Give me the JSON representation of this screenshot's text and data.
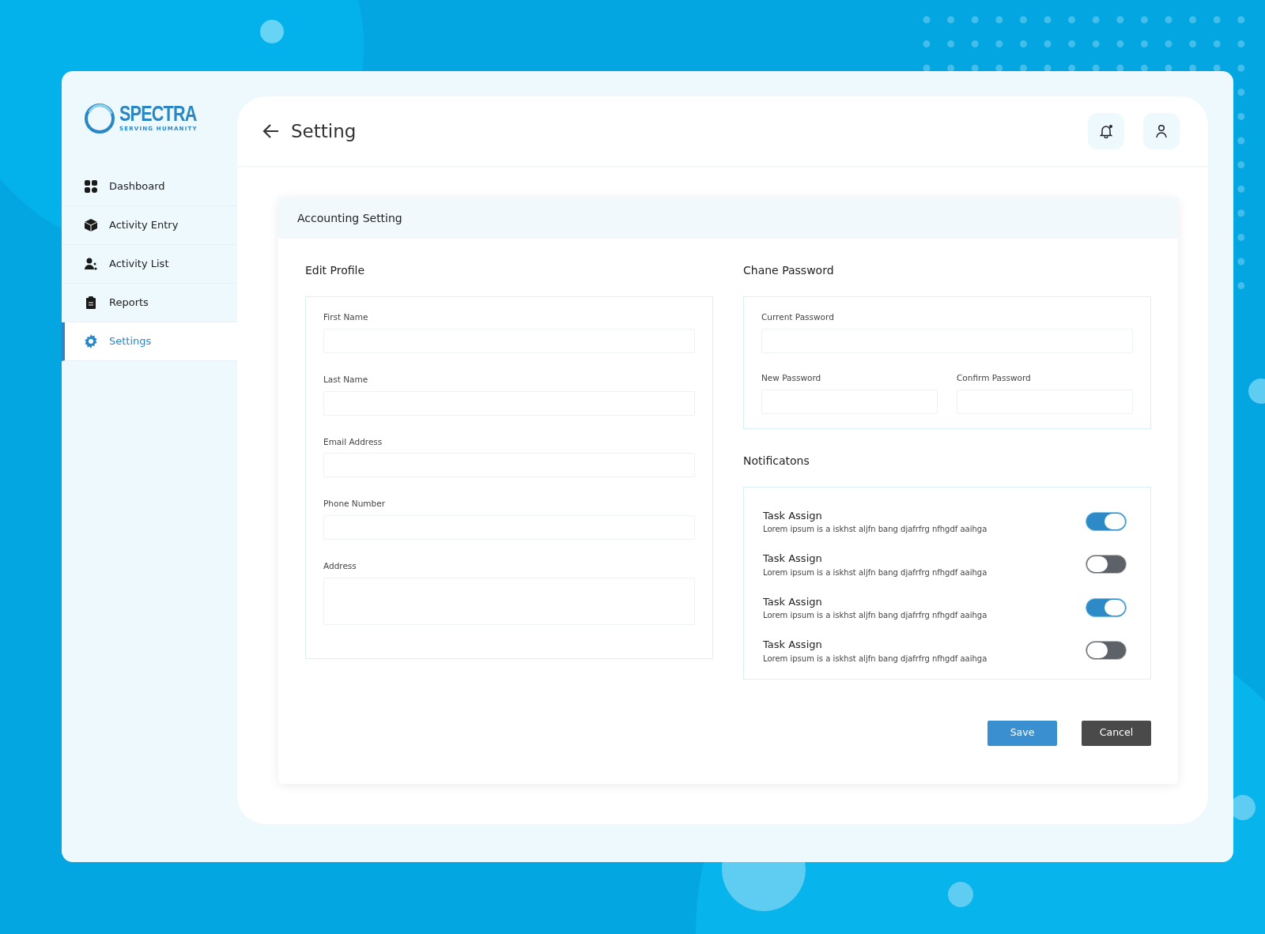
{
  "logo": {
    "name": "SPECTRA",
    "tagline": "SERVING HUMANITY"
  },
  "sidebar": {
    "items": [
      {
        "label": "Dashboard",
        "selected": false
      },
      {
        "label": "Activity Entry",
        "selected": false
      },
      {
        "label": "Activity List",
        "selected": false
      },
      {
        "label": "Reports",
        "selected": false
      },
      {
        "label": "Settings",
        "selected": true
      }
    ]
  },
  "header": {
    "title": "Setting",
    "notification_dot": true
  },
  "card": {
    "title": "Accounting Setting",
    "edit_profile": {
      "title": "Edit Profile",
      "fields": [
        {
          "label": "First Name",
          "kind": "input"
        },
        {
          "label": "Last Name",
          "kind": "input"
        },
        {
          "label": "Email Address",
          "kind": "input"
        },
        {
          "label": "Phone Number",
          "kind": "input"
        },
        {
          "label": "Address",
          "kind": "textarea"
        }
      ]
    },
    "change_password": {
      "title": "Chane Password",
      "fields": [
        {
          "label": "Current Password",
          "kind": "full"
        },
        {
          "label": "New Password",
          "kind": "half"
        },
        {
          "label": "Confirm Password",
          "kind": "half"
        }
      ]
    },
    "notifications": {
      "title": "Notificatons",
      "items": [
        {
          "title": "Task Assign",
          "text": "Lorem ipsum is a iskhst aljfn bang djafrfrg nfhgdf aaihga",
          "on": true
        },
        {
          "title": "Task Assign",
          "text": "Lorem ipsum is a iskhst aljfn bang djafrfrg nfhgdf aaihga",
          "on": false
        },
        {
          "title": "Task Assign",
          "text": "Lorem ipsum is a iskhst aljfn bang djafrfrg nfhgdf aaihga",
          "on": true
        },
        {
          "title": "Task Assign",
          "text": "Lorem ipsum is a iskhst aljfn bang djafrfrg nfhgdf aaihga",
          "on": false
        }
      ]
    },
    "buttons": [
      {
        "label": "Save",
        "kind": "primary"
      },
      {
        "label": "Cancel",
        "kind": "dark"
      }
    ]
  }
}
